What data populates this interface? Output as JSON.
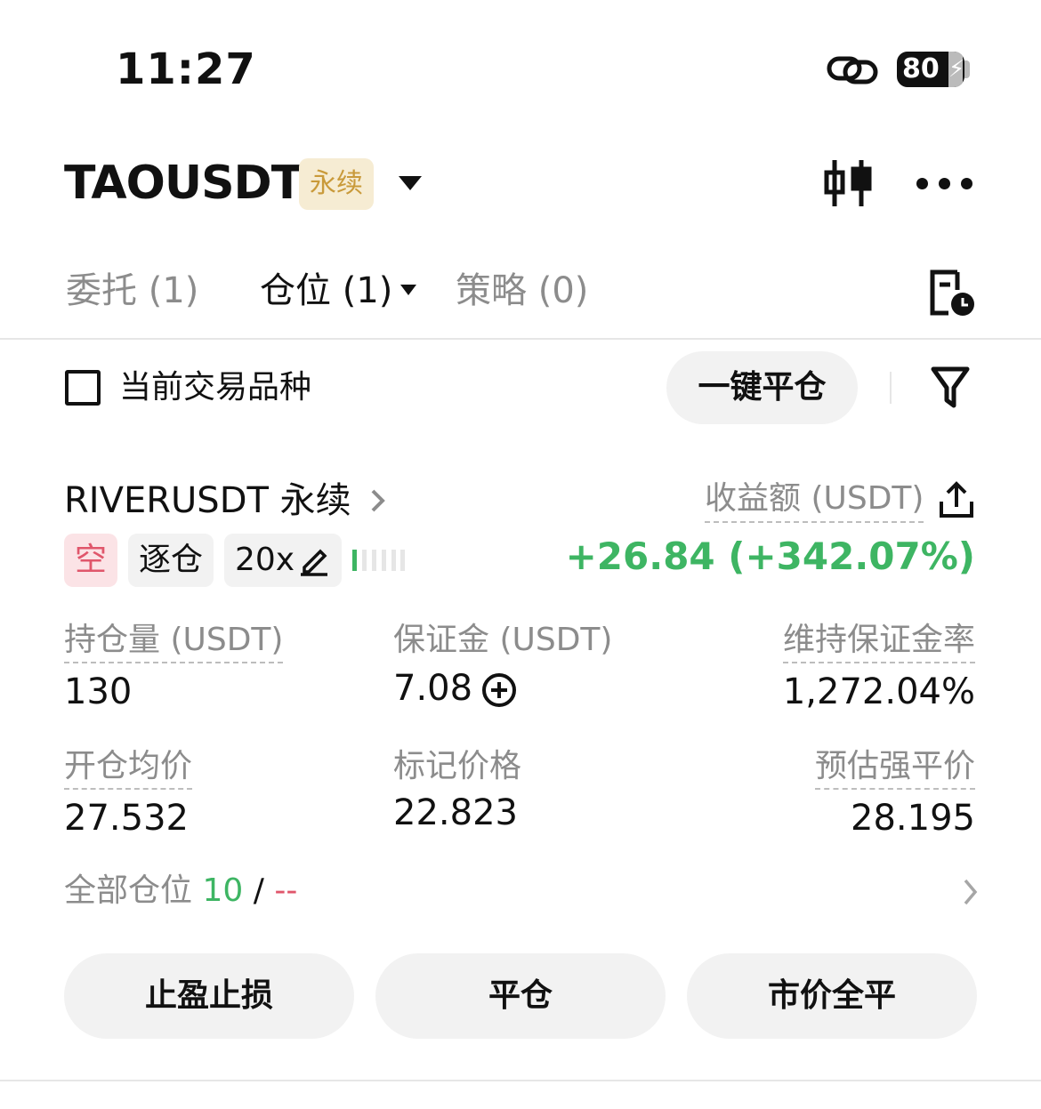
{
  "status_bar": {
    "time": "11:27",
    "battery": "80"
  },
  "header": {
    "symbol": "TAOUSDT",
    "contract_type": "永续",
    "icons": [
      "candlestick-icon",
      "more-icon"
    ]
  },
  "tabs": {
    "orders": "委托 (1)",
    "positions": "仓位 (1)",
    "strategy": "策略 (0)"
  },
  "toolbar": {
    "current_symbol_label": "当前交易品种",
    "close_all_label": "一键平仓"
  },
  "position": {
    "title": "RIVERUSDT 永续",
    "side": "空",
    "margin_mode": "逐仓",
    "leverage": "20x",
    "pnl_label": "收益额 (USDT)",
    "pnl_value": "+26.84 (+342.07%)",
    "size_label": "持仓量 (USDT)",
    "size_value": "130",
    "margin_label": "保证金 (USDT)",
    "margin_value": "7.08",
    "mmr_label": "维持保证金率",
    "mmr_value": "1,272.04%",
    "entry_label": "开仓均价",
    "entry_value": "27.532",
    "mark_label": "标记价格",
    "mark_value": "22.823",
    "liq_label": "预估强平价",
    "liq_value": "28.195"
  },
  "all_positions": {
    "label": "全部仓位",
    "count": "10",
    "separator": "/",
    "other": "--"
  },
  "actions": {
    "tp_sl": "止盈止损",
    "close": "平仓",
    "market_close_all": "市价全平"
  },
  "colors": {
    "profit": "#3eb563",
    "short": "#e0566b",
    "perp_badge": "#c99a3a"
  }
}
